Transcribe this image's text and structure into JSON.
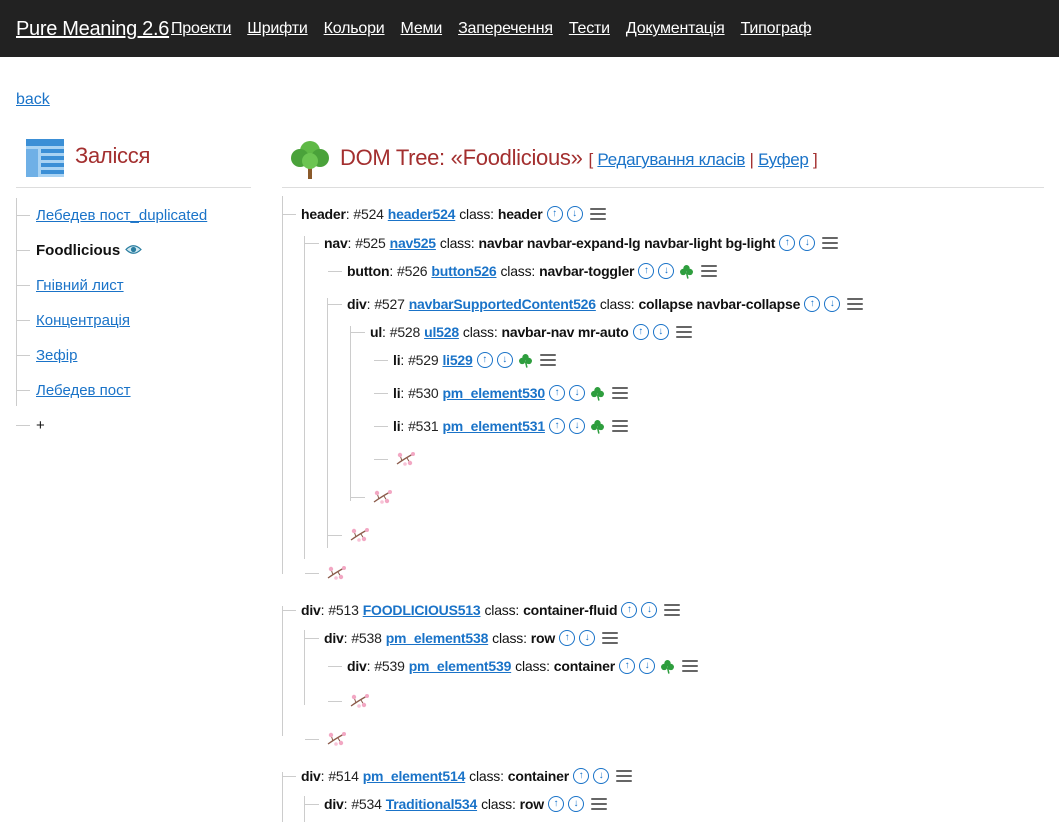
{
  "nav": {
    "brand": "Pure Meaning 2.6",
    "links": [
      "Проекти",
      "Шрифти",
      "Кольори",
      "Меми",
      "Заперечення",
      "Тести",
      "Документація",
      "Типограф"
    ]
  },
  "back_label": "back",
  "left": {
    "title": "Залісся",
    "items": [
      {
        "label": "Лебедев пост_duplicated",
        "active": false
      },
      {
        "label": "Foodlicious",
        "active": true
      },
      {
        "label": "Гнівний лист",
        "active": false
      },
      {
        "label": "Концентрація",
        "active": false
      },
      {
        "label": "Зефір",
        "active": false
      },
      {
        "label": "Лебедев пост",
        "active": false
      }
    ],
    "add_label": "+"
  },
  "right": {
    "title": "DOM Tree: «Foodlicious»",
    "bracket_open": "[",
    "edit_classes": "Редагування класів",
    "separator": "|",
    "buffer": "Буфер",
    "bracket_close": "]"
  },
  "tree": {
    "class_label": "class:",
    "nodes": [
      {
        "tag": "header",
        "num": "#524",
        "id": "header524",
        "cls": "header",
        "clover": false
      },
      {
        "tag": "nav",
        "num": "#525",
        "id": "nav525",
        "cls": "navbar navbar-expand-lg navbar-light bg-light",
        "clover": false
      },
      {
        "tag": "button",
        "num": "#526",
        "id": "button526",
        "cls": "navbar-toggler",
        "clover": true
      },
      {
        "tag": "div",
        "num": "#527",
        "id": "navbarSupportedContent526",
        "cls": "collapse navbar-collapse",
        "clover": false
      },
      {
        "tag": "ul",
        "num": "#528",
        "id": "ul528",
        "cls": "navbar-nav mr-auto",
        "clover": false
      },
      {
        "tag": "li",
        "num": "#529",
        "id": "li529",
        "cls": "",
        "clover": true
      },
      {
        "tag": "li",
        "num": "#530",
        "id": "pm_element530",
        "cls": "",
        "clover": true
      },
      {
        "tag": "li",
        "num": "#531",
        "id": "pm_element531",
        "cls": "",
        "clover": true
      },
      {
        "tag": "div",
        "num": "#513",
        "id": "FOODLICIOUS513",
        "cls": "container-fluid",
        "clover": false
      },
      {
        "tag": "div",
        "num": "#538",
        "id": "pm_element538",
        "cls": "row",
        "clover": false
      },
      {
        "tag": "div",
        "num": "#539",
        "id": "pm_element539",
        "cls": "container",
        "clover": true
      },
      {
        "tag": "div",
        "num": "#514",
        "id": "pm_element514",
        "cls": "container",
        "clover": false
      },
      {
        "tag": "div",
        "num": "#534",
        "id": "Traditional534",
        "cls": "row",
        "clover": false
      }
    ]
  },
  "colors": {
    "topbar": "#222222",
    "link": "#1a73c8",
    "title": "#a32f2f",
    "clover": "#2e9e3e"
  }
}
